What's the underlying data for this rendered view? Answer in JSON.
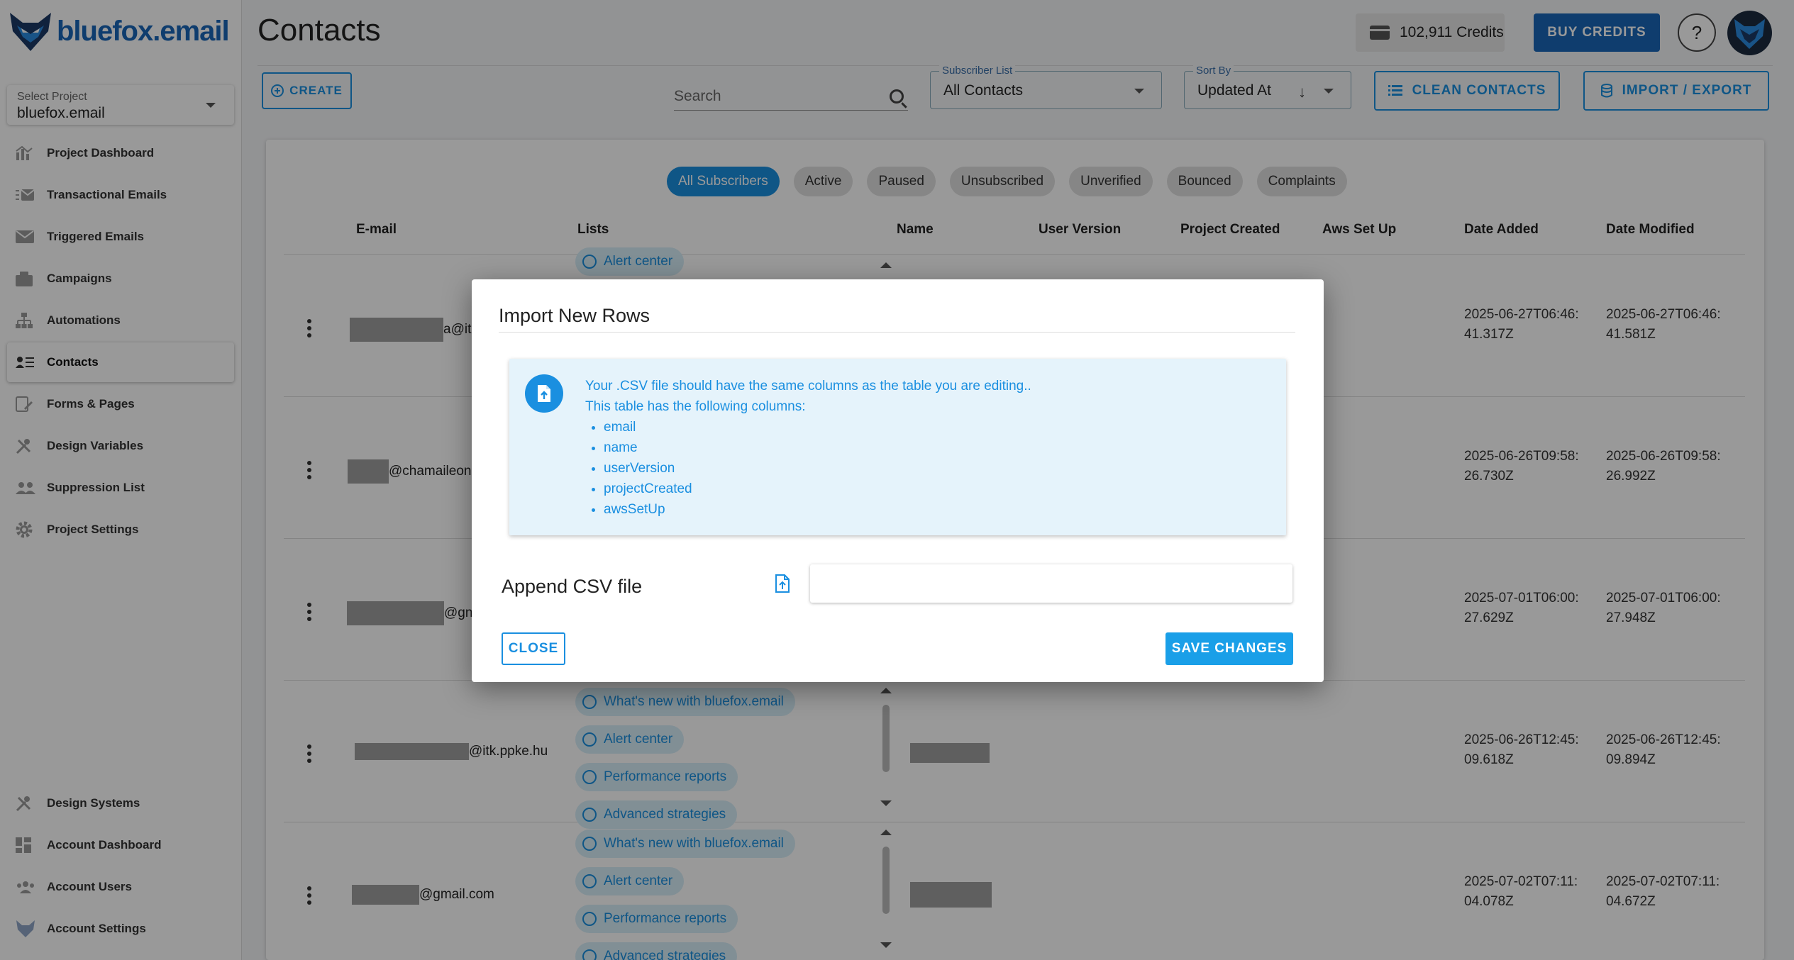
{
  "brand": {
    "name": "bluefox.email",
    "accent": "#1a66b8",
    "primary": "#1a8fe0"
  },
  "project_select": {
    "label": "Select Project",
    "value": "bluefox.email"
  },
  "sidebar": {
    "items": [
      {
        "label": "Project Dashboard",
        "icon": "chart-icon"
      },
      {
        "label": "Transactional Emails",
        "icon": "mail-list-icon"
      },
      {
        "label": "Triggered Emails",
        "icon": "mail-icon"
      },
      {
        "label": "Campaigns",
        "icon": "campaign-icon"
      },
      {
        "label": "Automations",
        "icon": "flow-icon"
      },
      {
        "label": "Contacts",
        "icon": "contacts-icon",
        "active": true
      },
      {
        "label": "Forms & Pages",
        "icon": "form-icon"
      },
      {
        "label": "Design Variables",
        "icon": "tools-icon"
      },
      {
        "label": "Suppression List",
        "icon": "people-block-icon"
      },
      {
        "label": "Project Settings",
        "icon": "gear-icon"
      }
    ],
    "bottom_items": [
      {
        "label": "Design Systems",
        "icon": "tools-icon"
      },
      {
        "label": "Account Dashboard",
        "icon": "dashboard-icon"
      },
      {
        "label": "Account Users",
        "icon": "users-icon"
      },
      {
        "label": "Account Settings",
        "icon": "fox-icon"
      }
    ]
  },
  "header": {
    "title": "Contacts",
    "credits": "102,911 Credits",
    "buy_credits": "BUY CREDITS",
    "help": "?"
  },
  "toolbar": {
    "create": "CREATE",
    "search_placeholder": "Search",
    "subscriber_list_label": "Subscriber List",
    "subscriber_list_value": "All Contacts",
    "sort_by_label": "Sort By",
    "sort_by_value": "Updated At",
    "clean_contacts": "CLEAN CONTACTS",
    "import_export": "IMPORT / EXPORT"
  },
  "filters": [
    "All Subscribers",
    "Active",
    "Paused",
    "Unsubscribed",
    "Unverified",
    "Bounced",
    "Complaints"
  ],
  "table": {
    "columns": [
      "E-mail",
      "Lists",
      "Name",
      "User Version",
      "Project Created",
      "Aws Set Up",
      "Date Added",
      "Date Modified"
    ],
    "rows": [
      {
        "email": "a@itk",
        "lists": [
          "Alert center"
        ],
        "date_added": "2025-06-27T06:46:41.317Z",
        "date_modified": "2025-06-27T06:46:41.581Z"
      },
      {
        "email": "@chamaileon",
        "lists": [],
        "date_added": "2025-06-26T09:58:26.730Z",
        "date_modified": "2025-06-26T09:58:26.992Z"
      },
      {
        "email": "@gn",
        "lists": [],
        "date_added": "2025-07-01T06:00:27.629Z",
        "date_modified": "2025-07-01T06:00:27.948Z"
      },
      {
        "email": "@itk.ppke.hu",
        "lists": [
          "What's new with bluefox.email",
          "Alert center",
          "Performance reports",
          "Advanced strategies"
        ],
        "date_added": "2025-06-26T12:45:09.618Z",
        "date_modified": "2025-06-26T12:45:09.894Z"
      },
      {
        "email": "@gmail.com",
        "lists": [
          "What's new with bluefox.email",
          "Alert center",
          "Performance reports",
          "Advanced strategies"
        ],
        "date_added": "2025-07-02T07:11:04.078Z",
        "date_modified": "2025-07-02T07:11:04.672Z"
      }
    ]
  },
  "dialog": {
    "title": "Import New Rows",
    "info_line1": "Your .CSV file should have the same columns as the table you are editing..",
    "info_line2": "This table has the following columns:",
    "columns": [
      "email",
      "name",
      "userVersion",
      "projectCreated",
      "awsSetUp"
    ],
    "append_label": "Append CSV file",
    "close": "CLOSE",
    "save": "SAVE CHANGES"
  }
}
